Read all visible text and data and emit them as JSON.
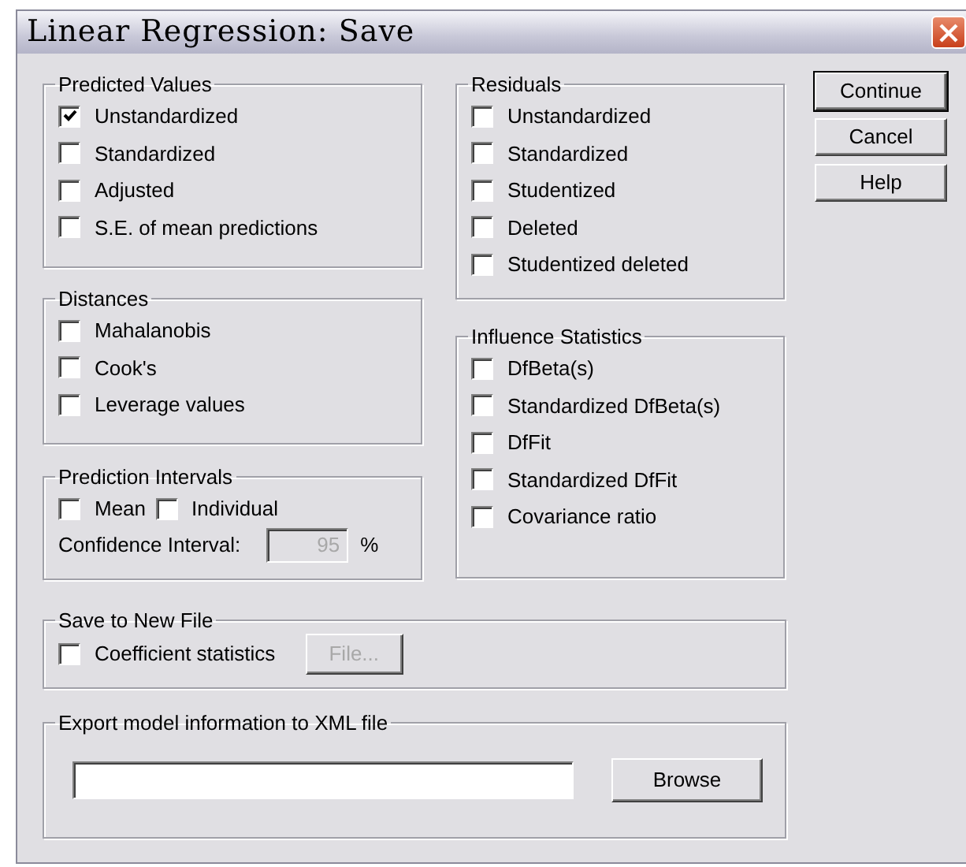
{
  "window": {
    "title": "Linear Regression: Save"
  },
  "predicted_values": {
    "title": "Predicted Values",
    "items": [
      {
        "label": "Unstandardized",
        "checked": true
      },
      {
        "label": "Standardized",
        "checked": false
      },
      {
        "label": "Adjusted",
        "checked": false
      },
      {
        "label": "S.E. of mean predictions",
        "checked": false
      }
    ]
  },
  "distances": {
    "title": "Distances",
    "items": [
      {
        "label": "Mahalanobis",
        "checked": false
      },
      {
        "label": "Cook's",
        "checked": false
      },
      {
        "label": "Leverage values",
        "checked": false
      }
    ]
  },
  "prediction_intervals": {
    "title": "Prediction Intervals",
    "items": [
      {
        "label": "Mean",
        "checked": false
      },
      {
        "label": "Individual",
        "checked": false
      }
    ],
    "confidence": {
      "label": "Confidence Interval:",
      "value": "95",
      "disabled": true,
      "suffix": "%"
    }
  },
  "residuals": {
    "title": "Residuals",
    "items": [
      {
        "label": "Unstandardized",
        "checked": false
      },
      {
        "label": "Standardized",
        "checked": false
      },
      {
        "label": "Studentized",
        "checked": false
      },
      {
        "label": "Deleted",
        "checked": false
      },
      {
        "label": "Studentized deleted",
        "checked": false
      }
    ]
  },
  "influence_statistics": {
    "title": "Influence Statistics",
    "items": [
      {
        "label": "DfBeta(s)",
        "checked": false
      },
      {
        "label": "Standardized DfBeta(s)",
        "checked": false
      },
      {
        "label": "DfFit",
        "checked": false
      },
      {
        "label": "Standardized DfFit",
        "checked": false
      },
      {
        "label": "Covariance ratio",
        "checked": false
      }
    ]
  },
  "save_to_new_file": {
    "title": "Save to New File",
    "item": {
      "label": "Coefficient statistics",
      "checked": false
    },
    "button": {
      "label": "File...",
      "disabled": true
    }
  },
  "export_xml": {
    "title": "Export model information to XML file",
    "button": {
      "label": "Browse",
      "disabled": false
    }
  },
  "buttons": [
    {
      "label": "Continue",
      "default": true
    },
    {
      "label": "Cancel",
      "default": false
    },
    {
      "label": "Help",
      "default": false
    }
  ]
}
